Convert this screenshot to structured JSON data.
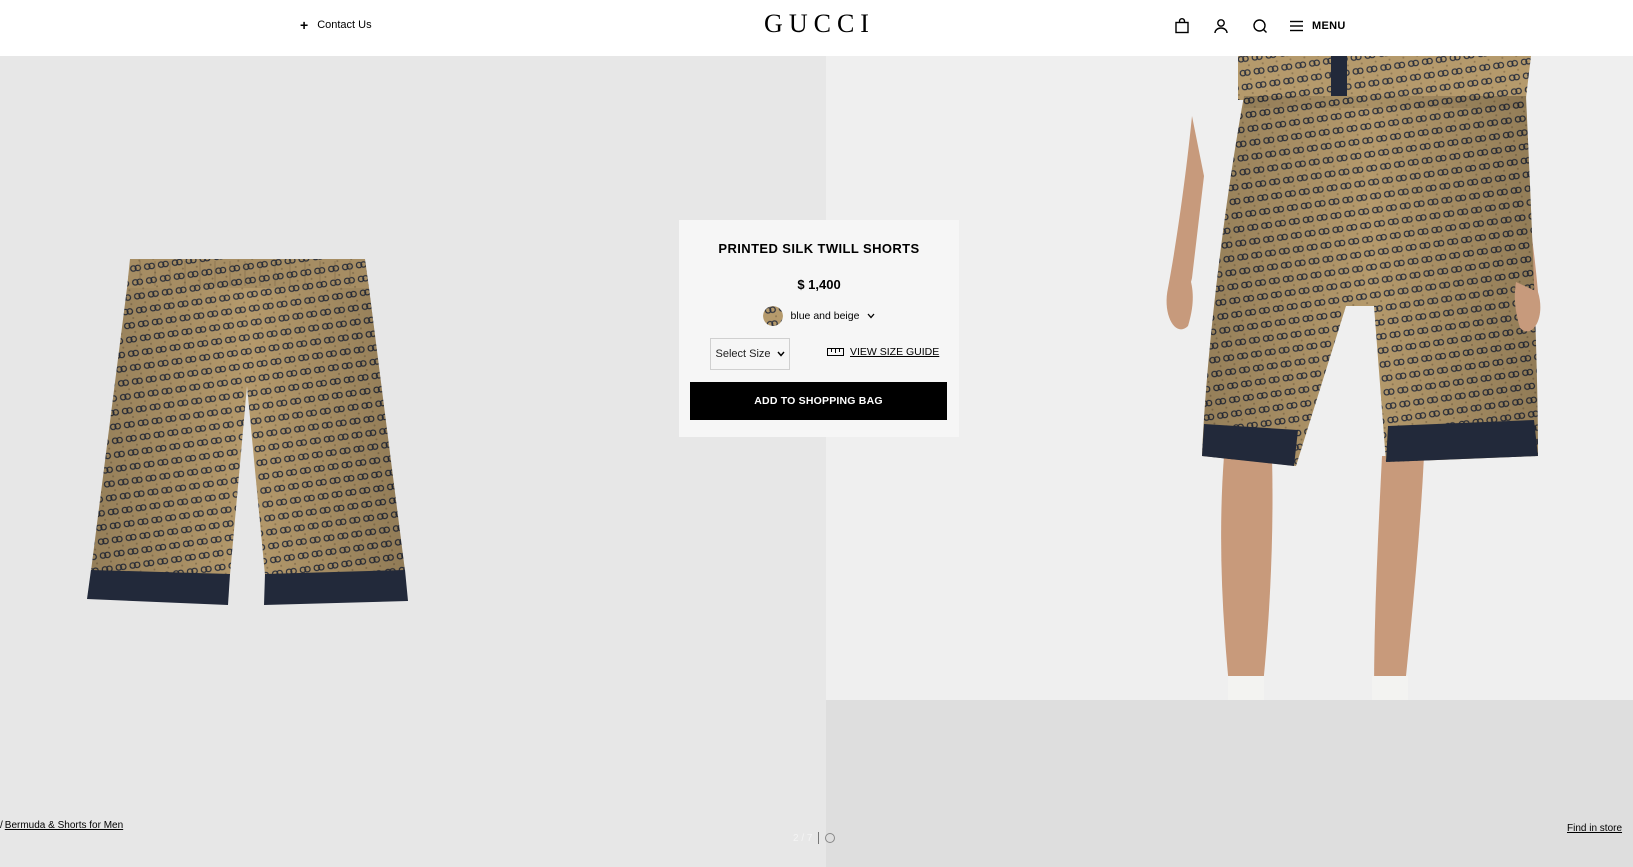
{
  "header": {
    "contact_label": "Contact Us",
    "logo": "GUCCI",
    "menu_label": "MENU"
  },
  "product": {
    "title": "PRINTED SILK TWILL SHORTS",
    "price": "$ 1,400",
    "color": "blue and beige",
    "size_placeholder": "Select Size",
    "size_guide_label": "VIEW SIZE GUIDE",
    "add_to_bag_label": "ADD TO SHOPPING BAG"
  },
  "breadcrumb": {
    "separator": "/",
    "current": "Bermuda & Shorts for Men"
  },
  "pager": {
    "label": "2 / 7"
  },
  "find_in_store_label": "Find in store",
  "colors": {
    "beige": "#b59a6c",
    "navy": "#22293a",
    "bg_left": "#e7e7e7",
    "bg_right": "#efefef",
    "button_black": "#000000"
  }
}
